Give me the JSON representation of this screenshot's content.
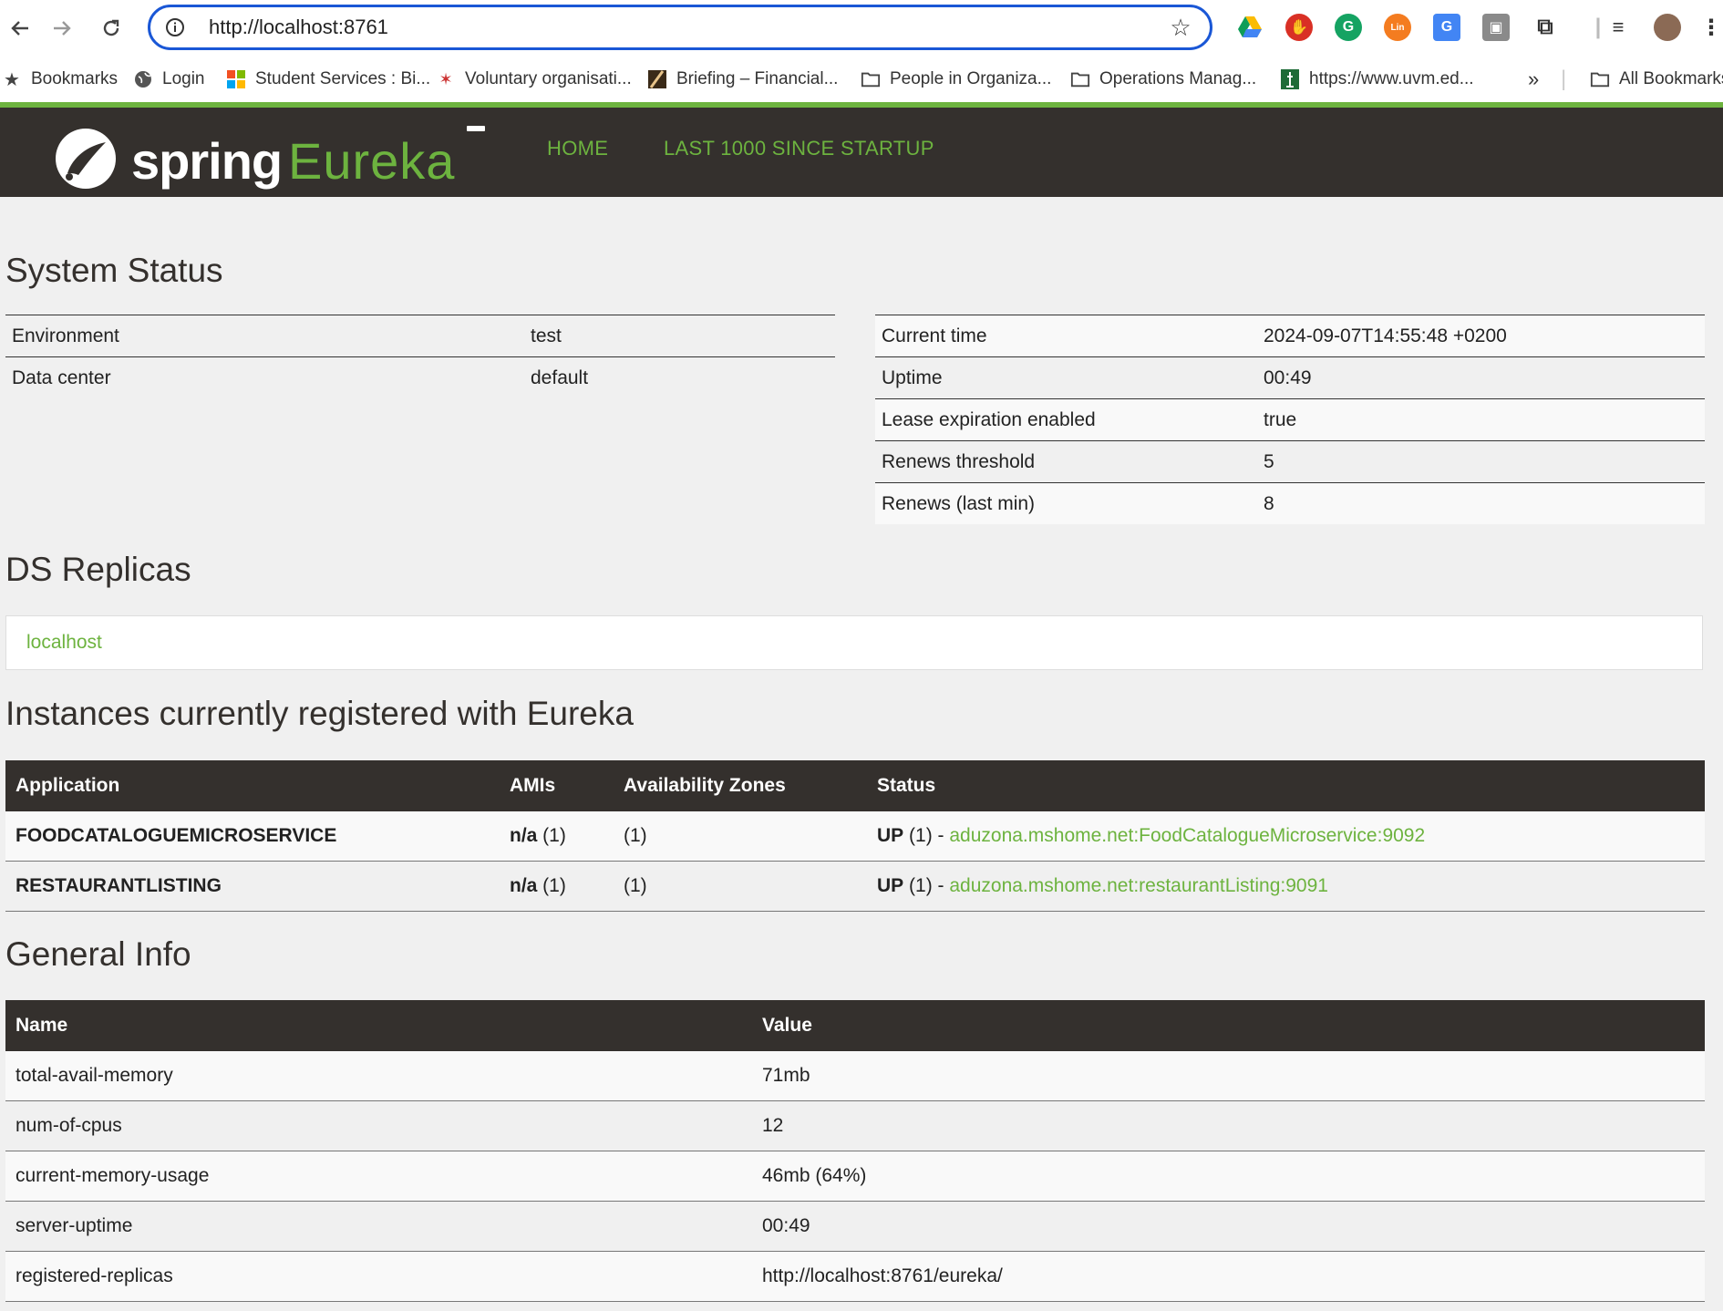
{
  "browser": {
    "url": "http://localhost:8761",
    "bookmarks": [
      {
        "label": "Bookmarks",
        "icon": "star-icon"
      },
      {
        "label": "Login",
        "icon": "globe-icon"
      },
      {
        "label": "Student Services : Bi...",
        "icon": "windows-logo-icon"
      },
      {
        "label": "Voluntary organisati...",
        "icon": "site-favicon-icon"
      },
      {
        "label": "Briefing – Financial...",
        "icon": "ft-favicon-icon"
      },
      {
        "label": "People in Organiza...",
        "icon": "folder-icon"
      },
      {
        "label": "Operations Manag...",
        "icon": "folder-icon"
      },
      {
        "label": "https://www.uvm.ed...",
        "icon": "uvm-favicon-icon"
      },
      {
        "label": "All Bookmarks",
        "icon": "folder-icon"
      }
    ]
  },
  "header": {
    "logo_spring": "spring",
    "logo_eureka": "Eureka",
    "nav": [
      "HOME",
      "LAST 1000 SINCE STARTUP"
    ]
  },
  "system_status": {
    "title": "System Status",
    "left": [
      {
        "key": "Environment",
        "value": "test"
      },
      {
        "key": "Data center",
        "value": "default"
      }
    ],
    "right": [
      {
        "key": "Current time",
        "value": "2024-09-07T14:55:48 +0200"
      },
      {
        "key": "Uptime",
        "value": "00:49"
      },
      {
        "key": "Lease expiration enabled",
        "value": "true"
      },
      {
        "key": "Renews threshold",
        "value": "5"
      },
      {
        "key": "Renews (last min)",
        "value": "8"
      }
    ]
  },
  "ds_replicas": {
    "title": "DS Replicas",
    "items": [
      "localhost"
    ]
  },
  "instances": {
    "title": "Instances currently registered with Eureka",
    "columns": [
      "Application",
      "AMIs",
      "Availability Zones",
      "Status"
    ],
    "rows": [
      {
        "app": "FOODCATALOGUEMICROSERVICE",
        "amis_bold": "n/a",
        "amis_count": " (1)",
        "zones": "(1)",
        "status_bold": "UP",
        "status_rest": " (1) - ",
        "link": "aduzona.mshome.net:FoodCatalogueMicroservice:9092"
      },
      {
        "app": "RESTAURANTLISTING",
        "amis_bold": "n/a",
        "amis_count": " (1)",
        "zones": "(1)",
        "status_bold": "UP",
        "status_rest": " (1) - ",
        "link": "aduzona.mshome.net:restaurantListing:9091"
      }
    ]
  },
  "general_info": {
    "title": "General Info",
    "columns": [
      "Name",
      "Value"
    ],
    "rows": [
      {
        "name": "total-avail-memory",
        "value": "71mb"
      },
      {
        "name": "num-of-cpus",
        "value": "12"
      },
      {
        "name": "current-memory-usage",
        "value": "46mb (64%)"
      },
      {
        "name": "server-uptime",
        "value": "00:49"
      },
      {
        "name": "registered-replicas",
        "value": "http://localhost:8761/eureka/"
      }
    ]
  }
}
